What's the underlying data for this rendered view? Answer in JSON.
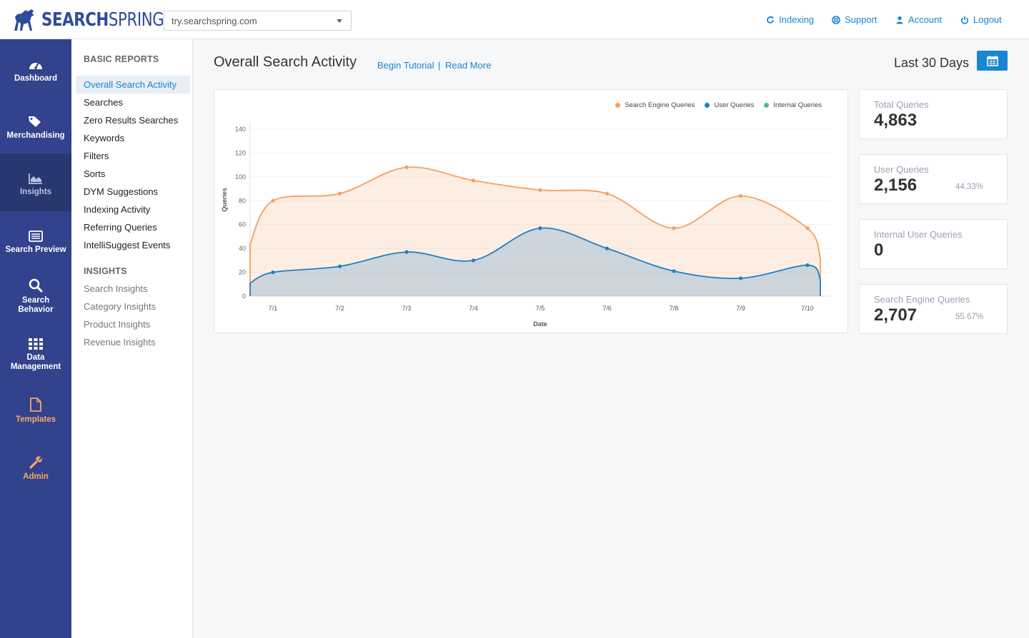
{
  "brand": {
    "name_bold": "SEARCH",
    "name_light": "SPRING"
  },
  "site_select": {
    "value": "try.searchspring.com"
  },
  "topnav": [
    {
      "label": "Indexing",
      "icon": "refresh-icon"
    },
    {
      "label": "Support",
      "icon": "lifebuoy-icon"
    },
    {
      "label": "Account",
      "icon": "user-icon"
    },
    {
      "label": "Logout",
      "icon": "power-icon"
    }
  ],
  "sidebar": {
    "items": [
      {
        "label": "Dashboard",
        "icon": "dashboard-icon"
      },
      {
        "label": "Merchandising",
        "icon": "tags-icon"
      },
      {
        "label": "Insights",
        "icon": "area-chart-icon"
      },
      {
        "label": "Search Preview",
        "icon": "list-icon"
      },
      {
        "label": "Search Behavior",
        "icon": "search-icon"
      },
      {
        "label": "Data Management",
        "icon": "grid-icon"
      },
      {
        "label": "Templates",
        "icon": "file-icon"
      },
      {
        "label": "Admin",
        "icon": "wrench-icon"
      }
    ]
  },
  "submenu": {
    "basic_heading": "BASIC REPORTS",
    "basic_items": [
      "Overall Search Activity",
      "Searches",
      "Zero Results Searches",
      "Keywords",
      "Filters",
      "Sorts",
      "DYM Suggestions",
      "Indexing Activity",
      "Referring Queries",
      "IntelliSuggest Events"
    ],
    "insights_heading": "INSIGHTS",
    "insights_items": [
      "Search Insights",
      "Category Insights",
      "Product Insights",
      "Revenue Insights"
    ]
  },
  "header": {
    "title": "Overall Search Activity",
    "tutorial_link": "Begin Tutorial",
    "separator": "|",
    "read_more_link": "Read More",
    "date_range": "Last 30 Days"
  },
  "stats": [
    {
      "label": "Total Queries",
      "value": "4,863",
      "percent": ""
    },
    {
      "label": "User Queries",
      "value": "2,156",
      "percent": "44.33%"
    },
    {
      "label": "Internal User Queries",
      "value": "0",
      "percent": ""
    },
    {
      "label": "Search Engine Queries",
      "value": "2,707",
      "percent": "55.67%"
    }
  ],
  "colors": {
    "search_engine": "#f4a062",
    "user": "#1f80c4",
    "internal": "#4cbd8f",
    "accent": "#1a85d0",
    "sidebar": "#32428c"
  },
  "chart_data": {
    "type": "area",
    "categories": [
      "7/1",
      "7/2",
      "7/3",
      "7/4",
      "7/5",
      "7/6",
      "7/8",
      "7/9",
      "7/10"
    ],
    "series": [
      {
        "name": "Search Engine Queries",
        "values": [
          80,
          86,
          108,
          97,
          89,
          86,
          57,
          84,
          57
        ]
      },
      {
        "name": "User Queries",
        "values": [
          20,
          25,
          37,
          30,
          57,
          40,
          21,
          15,
          26
        ]
      },
      {
        "name": "Internal Queries",
        "values": [
          0,
          0,
          0,
          0,
          0,
          0,
          0,
          0,
          0
        ]
      }
    ],
    "xlabel": "Date",
    "ylabel": "Queries",
    "ylim": [
      0,
      140
    ],
    "yticks": [
      0,
      20,
      40,
      60,
      80,
      100,
      120,
      140
    ],
    "grid": true,
    "legend": "top-right"
  }
}
